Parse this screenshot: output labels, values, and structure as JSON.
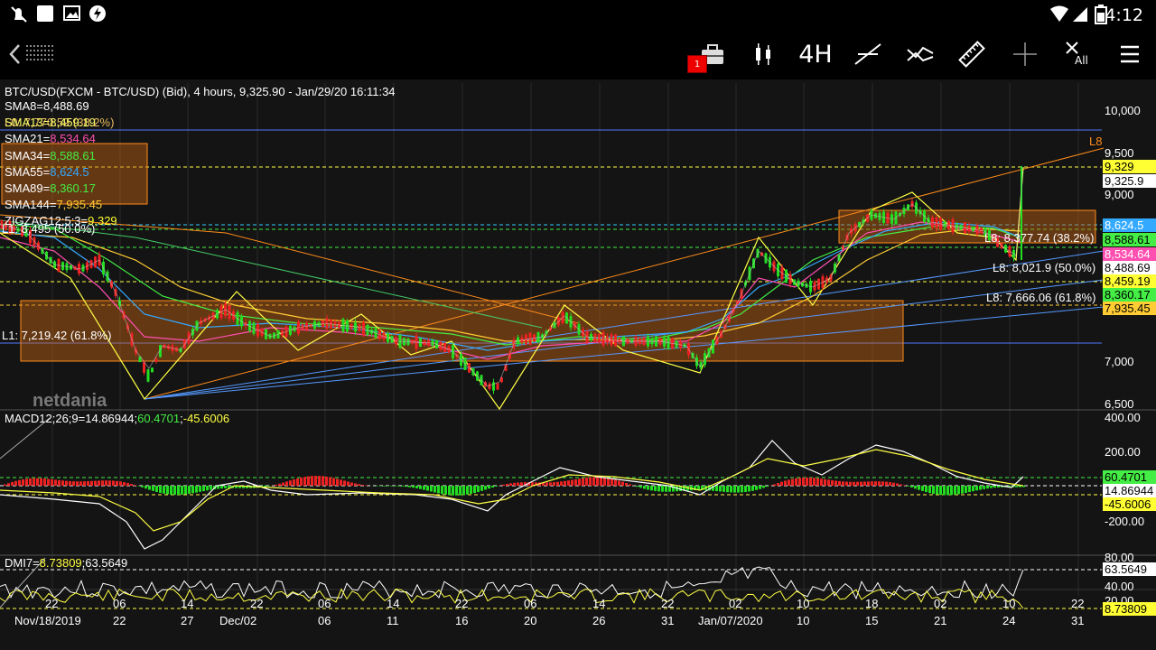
{
  "status_bar": {
    "time": "4:12",
    "left_icons": [
      "notification-mute-icon",
      "square-icon",
      "image-icon",
      "flash-app-icon"
    ],
    "right_icons": [
      "wifi-icon",
      "signal-icon",
      "battery-icon"
    ]
  },
  "toolbar": {
    "badge_count": "1",
    "timeframe_label": "4H",
    "close_all_label": "All"
  },
  "chart": {
    "header": "BTC/USD(FXCM - BTC/USD) (Bid),  4 hours, 9,325.90 - Jan/29/20 16:11:34",
    "overlay_l0": "L0: 7,770.59 (38.2%)",
    "sma_legend": [
      {
        "text": "SMA8=8,488.69",
        "color": "#ffffff"
      },
      {
        "text": "SMA13=8,459.19",
        "color": "#ffff66"
      },
      {
        "text": "SMA21=",
        "value": "8,534.64",
        "color": "#ffffff",
        "value_color": "#ff4fb0"
      },
      {
        "text": "SMA34=",
        "value": "8,588.61",
        "color": "#ffffff",
        "value_color": "#44ee44"
      },
      {
        "text": "SMA55=",
        "value": "8,624.5",
        "color": "#ffffff",
        "value_color": "#33aaff"
      },
      {
        "text": "SMA89=",
        "value": "8,360.17",
        "color": "#ffffff",
        "value_color": "#44ee44"
      },
      {
        "text": "SMA144=",
        "value": "7,935.45",
        "color": "#ffffff",
        "value_color": "#ffcc33"
      },
      {
        "text": "ZIGZAG12;5;3=",
        "value": "9,329",
        "color": "#ffffff",
        "value_color": "#ffff33"
      }
    ],
    "fib_left_label": "L1: 8,495 (50.0%)",
    "fib_l1_618": "L1: 7,219.42 (61.8%)",
    "fib_l8_382": "L8: 8,377.74 (38.2%)",
    "fib_l8_500": "L8: 8,021.9 (50.0%)",
    "fib_l8_618": "L8: 7,666.06 (61.8%)",
    "l8_tag": "L8",
    "price_axis": [
      "10,000",
      "9,500",
      "9,000",
      "7,000",
      "6,500"
    ],
    "price_tags": [
      {
        "label": "9,329",
        "bg": "#ffff33",
        "fg": "#000000"
      },
      {
        "label": "9,325.9",
        "bg": "#ffffff",
        "fg": "#000000"
      },
      {
        "label": "8,624.5",
        "bg": "#33aaff",
        "fg": "#ffffff"
      },
      {
        "label": "8,588.61",
        "bg": "#44ee44",
        "fg": "#000000"
      },
      {
        "label": "8,534.64",
        "bg": "#ff4fb0",
        "fg": "#ffffff"
      },
      {
        "label": "8,488.69",
        "bg": "#ffffff",
        "fg": "#000000"
      },
      {
        "label": "8,459.19",
        "bg": "#ffff33",
        "fg": "#000000"
      },
      {
        "label": "8,360.17",
        "bg": "#44ee44",
        "fg": "#000000"
      },
      {
        "label": "7,935.45",
        "bg": "#ffcc33",
        "fg": "#000000"
      }
    ],
    "watermark": "netdania"
  },
  "macd": {
    "legend_prefix": "MACD12;26;9=",
    "legend_v1": "14.86944",
    "legend_v2": "60.4701",
    "legend_v3": "-45.6006",
    "axis": [
      "400.00",
      "200.00",
      "-200.00"
    ],
    "tags": [
      {
        "label": "60.4701",
        "bg": "#44ee44",
        "fg": "#000000"
      },
      {
        "label": "14.86944",
        "bg": "#ffffff",
        "fg": "#000000"
      },
      {
        "label": "-45.6006",
        "bg": "#ffff33",
        "fg": "#000000"
      }
    ]
  },
  "dmi": {
    "legend_prefix": "DMI7=",
    "legend_v1": "8.73809",
    "legend_v2": "63.5649",
    "axis": [
      "80.00",
      "40.00",
      "20.00"
    ],
    "tags": [
      {
        "label": "63.5649",
        "bg": "#ffffff",
        "fg": "#000000"
      },
      {
        "label": "8.73809",
        "bg": "#ffff33",
        "fg": "#000000"
      }
    ]
  },
  "x_axis": {
    "days": [
      "22",
      "06",
      "14",
      "22",
      "06",
      "14",
      "22",
      "06",
      "14",
      "22",
      "02",
      "10",
      "18",
      "02",
      "10",
      "22"
    ],
    "days2": [
      "Nov/18/2019",
      "22",
      "27",
      "Dec/02",
      "06",
      "11",
      "16",
      "20",
      "26",
      "31",
      "Jan/07/2020",
      "10",
      "15",
      "21",
      "24",
      "31"
    ]
  }
}
